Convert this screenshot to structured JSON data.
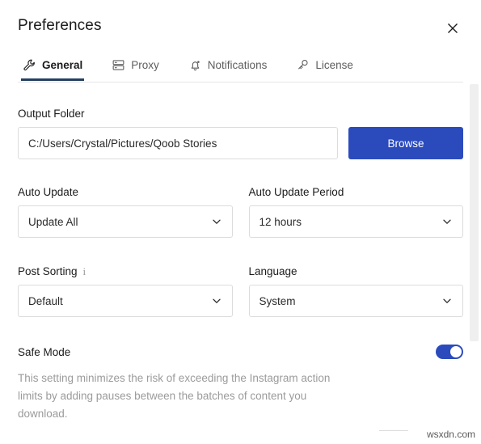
{
  "window": {
    "title": "Preferences",
    "close_icon": "close-icon"
  },
  "tabs": [
    {
      "label": "General",
      "icon": "wrench-icon",
      "active": true
    },
    {
      "label": "Proxy",
      "icon": "server-stack-icon",
      "active": false
    },
    {
      "label": "Notifications",
      "icon": "bell-icon",
      "active": false
    },
    {
      "label": "License",
      "icon": "key-icon",
      "active": false
    }
  ],
  "general": {
    "output_folder": {
      "label": "Output Folder",
      "value": "C:/Users/Crystal/Pictures/Qoob Stories",
      "placeholder": "C:/Users/Crystal/Pictures/Qoob Stories",
      "browse_label": "Browse"
    },
    "auto_update": {
      "label": "Auto Update",
      "value": "Update All"
    },
    "auto_update_period": {
      "label": "Auto Update Period",
      "value": "12 hours"
    },
    "post_sorting": {
      "label": "Post Sorting",
      "info_icon": "info-icon",
      "value": "Default"
    },
    "language": {
      "label": "Language",
      "value": "System"
    },
    "safe_mode": {
      "label": "Safe Mode",
      "enabled": true,
      "description": "This setting minimizes the risk of exceeding the Instagram action limits by adding pauses between the batches of content you download."
    }
  },
  "watermark": "wsxdn.com",
  "colors": {
    "accent_blue": "#2b4bbd",
    "active_tab_underline": "#24405e",
    "border": "#dcdcdc",
    "muted_text": "#9b9b9b"
  }
}
